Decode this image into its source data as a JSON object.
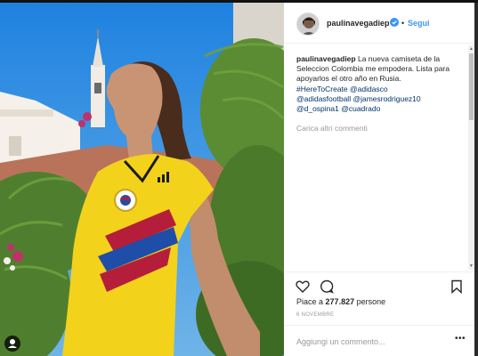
{
  "post": {
    "username": "paulinavegadiep",
    "follow_label": "Segui",
    "separator": "•",
    "caption": {
      "user": "paulinavegadiep",
      "text": "La nueva camiseta de la Seleccion Colombia me empodera. Lista para apoyarlos el otro año en Rusia.",
      "tags_line1": "#HereToCreate @adidasco",
      "tags_line2": "@adidasfootball @jamesrodriguez10",
      "tags_line3": "@d_ospina1 @cuadrado"
    },
    "load_more_label": "Carica altri commenti",
    "likes_count": "277.827",
    "likes_prefix": "Piace a",
    "likes_suffix": "persone",
    "date": "6 NOVEMBRE",
    "comment_placeholder": "Aggiungi un commento...",
    "more_label": "•••"
  },
  "colors": {
    "link": "#3897f0",
    "text": "#262626",
    "muted": "#999999",
    "jersey_yellow": "#f3d21c",
    "jersey_red": "#b51e3a",
    "jersey_blue": "#1f4ea8",
    "sky": "#3a8fd6"
  },
  "icons": [
    "user-tag-icon",
    "verified-badge-icon",
    "heart-icon",
    "comment-icon",
    "bookmark-icon"
  ]
}
